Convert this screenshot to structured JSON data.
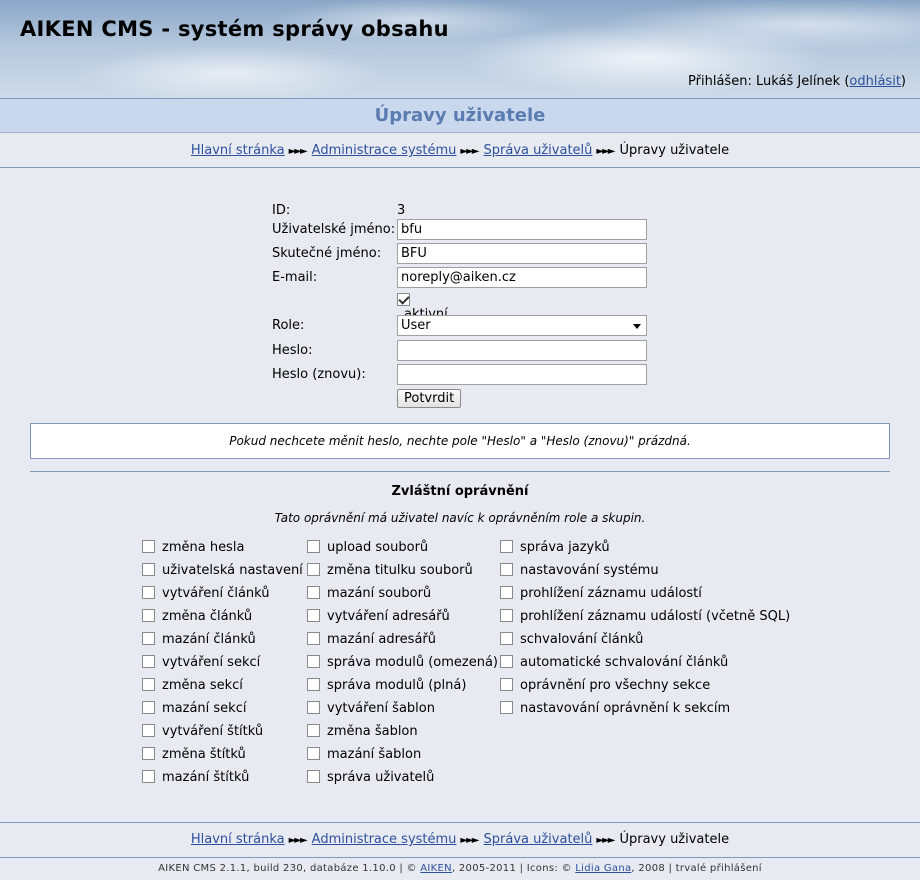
{
  "header": {
    "app_title": "AIKEN CMS - systém správy obsahu",
    "login_prefix": "Přihlášen: Lukáš Jelínek (",
    "logout_link": "odhlásit",
    "login_suffix": ")"
  },
  "page_title": "Úpravy uživatele",
  "breadcrumb": {
    "home": "Hlavní stránka",
    "admin": "Administrace systému",
    "users": "Správa uživatelů",
    "current": "Úpravy uživatele",
    "separator": "►►►"
  },
  "form": {
    "id_label": "ID:",
    "id_value": "3",
    "username_label": "Uživatelské jméno:",
    "username_value": "bfu",
    "realname_label": "Skutečné jméno:",
    "realname_value": "BFU",
    "email_label": "E-mail:",
    "email_value": "noreply@aiken.cz",
    "active_label": "aktivní",
    "active_checked": true,
    "role_label": "Role:",
    "role_value": "User",
    "password_label": "Heslo:",
    "password_value": "",
    "password2_label": "Heslo (znovu):",
    "password2_value": "",
    "submit_label": "Potvrdit"
  },
  "note": "Pokud nechcete měnit heslo, nechte pole \"Heslo\" a \"Heslo (znovu)\" prázdná.",
  "permissions": {
    "title": "Zvláštní oprávnění",
    "subtitle": "Tato oprávnění má uživatel navíc k oprávněním role a skupin.",
    "col1": [
      "změna hesla",
      "uživatelská nastavení",
      "vytváření článků",
      "změna článků",
      "mazání článků",
      "vytváření sekcí",
      "změna sekcí",
      "mazání sekcí",
      "vytváření štítků",
      "změna štítků",
      "mazání štítků"
    ],
    "col2": [
      "upload souborů",
      "změna titulku souborů",
      "mazání souborů",
      "vytváření adresářů",
      "mazání adresářů",
      "správa modulů (omezená)",
      "správa modulů (plná)",
      "vytváření šablon",
      "změna šablon",
      "mazání šablon",
      "správa uživatelů"
    ],
    "col3": [
      "správa jazyků",
      "nastavování systému",
      "prohlížení záznamu událostí",
      "prohlížení záznamu událostí (včetně SQL)",
      "schvalování článků",
      "automatické schvalování článků",
      "oprávnění pro všechny sekce",
      "nastavování oprávnění k sekcím"
    ]
  },
  "footer": {
    "version": "AIKEN CMS 2.1.1, build 230, databáze 1.10.0 | © ",
    "aiken_link": "AIKEN",
    "years": ", 2005-2011 | Icons: © ",
    "icons_link": "Lidia Gana",
    "icons_year": ", 2008 | trvalé přihlášení"
  }
}
